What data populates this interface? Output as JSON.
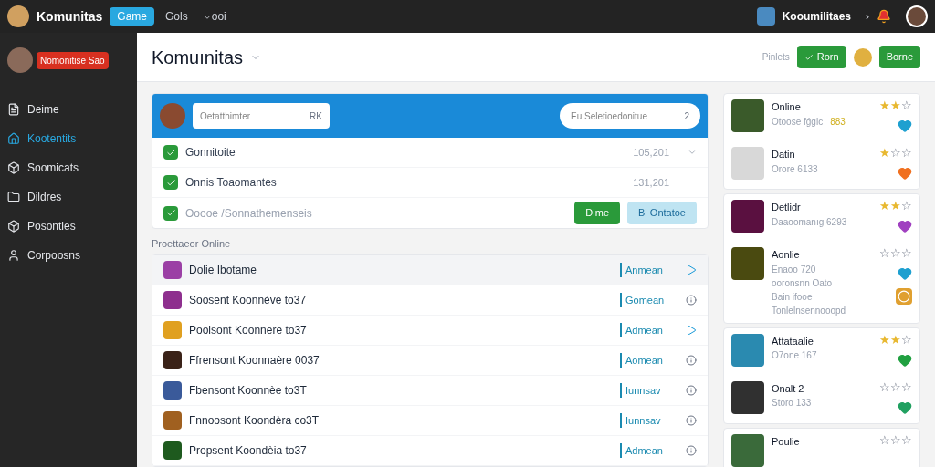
{
  "topbar": {
    "brand": "Komunitas",
    "tabs": [
      {
        "label": "Game",
        "selected": true
      },
      {
        "label": "Gols",
        "selected": false
      },
      {
        "label": "ooi",
        "selected": false
      }
    ],
    "user_name": "Kooumilitaes",
    "chevron": "›"
  },
  "sidebar": {
    "badge": "Nomonitise Sao",
    "items": [
      {
        "label": "Deime",
        "selected": false
      },
      {
        "label": "Kootentits",
        "selected": true
      },
      {
        "label": "Soomicats",
        "selected": false
      },
      {
        "label": "Dildres",
        "selected": false
      },
      {
        "label": "Posonties",
        "selected": false
      },
      {
        "label": "Corpoosns",
        "selected": false
      }
    ]
  },
  "header": {
    "title": "Komuınitas",
    "hint": "Pinlets",
    "buttons": [
      "Rorn",
      "Borne"
    ]
  },
  "panel": {
    "search_left": {
      "placeholder": "Oetatthimter",
      "suffix": "RK"
    },
    "search_right": {
      "placeholder": "Eu Seletioedonitue",
      "suffix": "2"
    },
    "checks": [
      {
        "label": "Gonnitoite",
        "checked": true,
        "disabled": false,
        "value": "105,201"
      },
      {
        "label": "Onnis Toaomantes",
        "checked": true,
        "disabled": false,
        "value": "131,201"
      },
      {
        "label": "Ooooe /Sonnathemenseis",
        "checked": true,
        "disabled": true
      }
    ],
    "actions": [
      {
        "kind": "primary",
        "label": "Dime"
      },
      {
        "kind": "secondary",
        "label": "Bi Ontatoe"
      }
    ]
  },
  "section_label": "Proettaeor Online",
  "list": [
    {
      "name": "Dolie Ibotame",
      "link": "Anmean",
      "color": "#9b3fa5",
      "active": true,
      "selected": true
    },
    {
      "name": "Soosent Koonnève to37",
      "link": "Gomean",
      "color": "#8e2f8e",
      "active": false,
      "selected": false
    },
    {
      "name": "Pooisont Koonnere to37",
      "link": "Admean",
      "color": "#e0a020",
      "active": true,
      "selected": false
    },
    {
      "name": "Ffrensont Koonnaère 0037",
      "link": "Aomean",
      "color": "#3a2218",
      "active": false,
      "selected": false
    },
    {
      "name": "Fbensont Koonnèe to3T",
      "link": "Iunnsav",
      "color": "#3a5a9a",
      "active": false,
      "selected": false
    },
    {
      "name": "Fnnoosont Koondèra co3T",
      "link": "Iunnsav",
      "color": "#a06020",
      "active": false,
      "selected": false
    },
    {
      "name": "Propsent Koondèia to37",
      "link": "Admean",
      "color": "#1e5a1e",
      "active": false,
      "selected": false
    }
  ],
  "games": [
    [
      {
        "title": "Online",
        "lines": [
          "Otoose fǵgic"
        ],
        "extra": "883",
        "stars": 2,
        "color": "#1ea0d0"
      },
      {
        "title": "Datin",
        "lines": [
          "Orore 6133"
        ],
        "stars": 1,
        "color": "#f07020"
      }
    ],
    [
      {
        "title": "Detlidr",
        "lines": [
          "Daaoomanıg 6293"
        ],
        "stars": 2,
        "color": "#a040c0"
      },
      {
        "title": "Aonlie",
        "lines": [
          "Enaoo 720",
          "ooronsnn Oato",
          "Bain ifooe",
          "Tonlelnsennooopd"
        ],
        "badge": true,
        "stars": 0,
        "color": "#1ea0d0"
      }
    ],
    [
      {
        "title": "Attataalie",
        "lines": [
          "O7one 167"
        ],
        "stars": 2,
        "color": "#20a040"
      },
      {
        "title": "Onalt 2",
        "lines": [
          "Storo 133"
        ],
        "stars": 0,
        "color": "#20a060"
      }
    ],
    [
      {
        "title": "Poulie",
        "stars": 0
      }
    ]
  ]
}
